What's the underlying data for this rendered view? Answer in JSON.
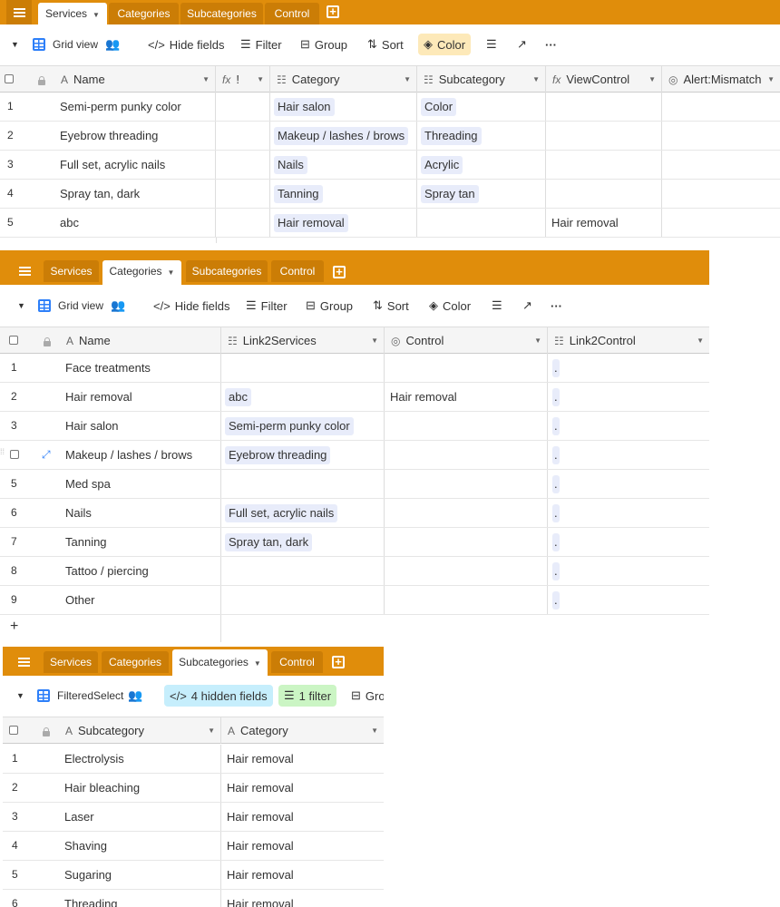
{
  "panels": [
    {
      "tabs": [
        {
          "label": "Services",
          "active": true
        },
        {
          "label": "Categories",
          "active": false
        },
        {
          "label": "Subcategories",
          "active": false
        },
        {
          "label": "Control",
          "active": false
        }
      ],
      "toolbar": {
        "view_name": "Grid view",
        "hide_fields": "Hide fields",
        "filter": "Filter",
        "group": "Group",
        "sort": "Sort",
        "color": "Color"
      },
      "columns": [
        "Name",
        "!",
        "Category",
        "Subcategory",
        "ViewControl",
        "Alert:Mismatch"
      ],
      "rows": [
        {
          "num": "1",
          "name": "Semi-perm punky color",
          "category": "Hair salon",
          "subcategory": "Color",
          "viewcontrol": ""
        },
        {
          "num": "2",
          "name": "Eyebrow threading",
          "category": "Makeup / lashes / brows",
          "subcategory": "Threading",
          "viewcontrol": ""
        },
        {
          "num": "3",
          "name": "Full set, acrylic nails",
          "category": "Nails",
          "subcategory": "Acrylic",
          "viewcontrol": ""
        },
        {
          "num": "4",
          "name": "Spray tan, dark",
          "category": "Tanning",
          "subcategory": "Spray tan",
          "viewcontrol": ""
        },
        {
          "num": "5",
          "name": "abc",
          "category": "Hair removal",
          "subcategory": "",
          "viewcontrol": "Hair removal"
        }
      ]
    },
    {
      "tabs": [
        {
          "label": "Services",
          "active": false
        },
        {
          "label": "Categories",
          "active": true
        },
        {
          "label": "Subcategories",
          "active": false
        },
        {
          "label": "Control",
          "active": false
        }
      ],
      "toolbar": {
        "view_name": "Grid view",
        "hide_fields": "Hide fields",
        "filter": "Filter",
        "group": "Group",
        "sort": "Sort",
        "color": "Color"
      },
      "columns": [
        "Name",
        "Link2Services",
        "Control",
        "Link2Control"
      ],
      "rows": [
        {
          "num": "1",
          "name": "Face treatments",
          "link": "",
          "control": "",
          "link2": "."
        },
        {
          "num": "2",
          "name": "Hair removal",
          "link": "abc",
          "control": "Hair removal",
          "link2": "."
        },
        {
          "num": "",
          "name": "Makeup / lashes / brows",
          "link": "Eyebrow threading",
          "control": "",
          "link2": "."
        },
        {
          "num": "3",
          "name": "Hair salon",
          "link": "Semi-perm punky color",
          "control": "",
          "link2": "."
        },
        {
          "num": "5",
          "name": "Med spa",
          "link": "",
          "control": "",
          "link2": "."
        },
        {
          "num": "6",
          "name": "Nails",
          "link": "Full set, acrylic nails",
          "control": "",
          "link2": "."
        },
        {
          "num": "7",
          "name": "Tanning",
          "link": "Spray tan, dark",
          "control": "",
          "link2": "."
        },
        {
          "num": "8",
          "name": "Tattoo / piercing",
          "link": "",
          "control": "",
          "link2": "."
        },
        {
          "num": "9",
          "name": "Other",
          "link": "",
          "control": "",
          "link2": "."
        }
      ],
      "add_row": "+"
    },
    {
      "tabs": [
        {
          "label": "Services",
          "active": false
        },
        {
          "label": "Categories",
          "active": false
        },
        {
          "label": "Subcategories",
          "active": true
        },
        {
          "label": "Control",
          "active": false
        }
      ],
      "toolbar": {
        "view_name": "FilteredSelect",
        "hidden_fields": "4 hidden fields",
        "filter": "1 filter",
        "group_partial": "Gro"
      },
      "columns": [
        "Subcategory",
        "Category"
      ],
      "rows": [
        {
          "num": "1",
          "subcategory": "Electrolysis",
          "category": "Hair removal"
        },
        {
          "num": "2",
          "subcategory": "Hair bleaching",
          "category": "Hair removal"
        },
        {
          "num": "3",
          "subcategory": "Laser",
          "category": "Hair removal"
        },
        {
          "num": "4",
          "subcategory": "Shaving",
          "category": "Hair removal"
        },
        {
          "num": "5",
          "subcategory": "Sugaring",
          "category": "Hair removal"
        },
        {
          "num": "6",
          "subcategory": "Threading",
          "category": "Hair removal"
        }
      ]
    }
  ],
  "colors": {
    "tabbar": "#e08d0b",
    "tab_inactive": "#cb7d06",
    "accent_blue": "#2d7ff9",
    "pill": "#e8ecfa"
  }
}
